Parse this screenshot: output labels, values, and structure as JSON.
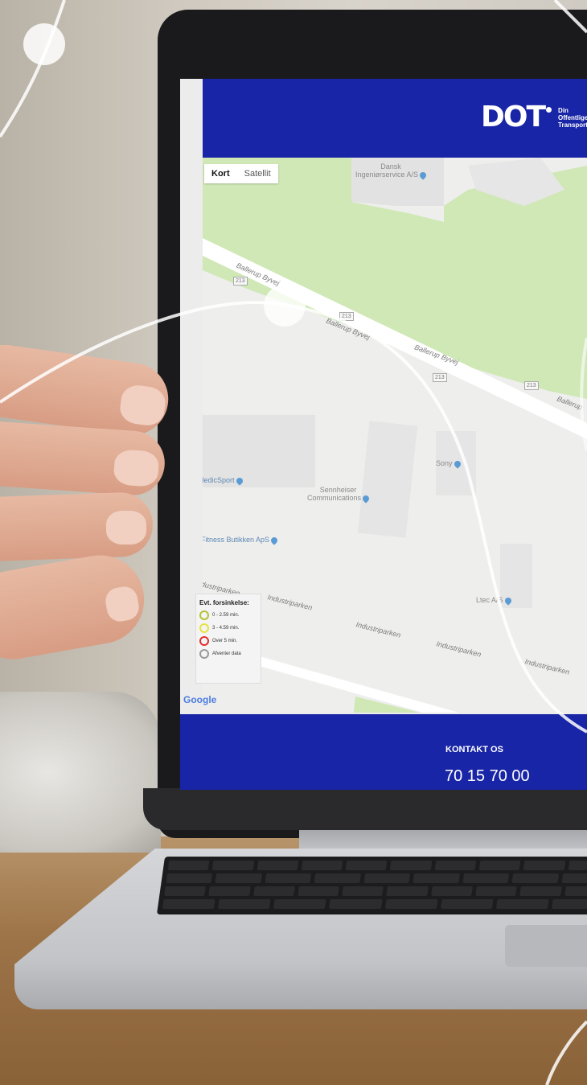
{
  "site": {
    "logo": "DOT",
    "logo_tagline": [
      "Din",
      "Offentlige",
      "Transport"
    ]
  },
  "map": {
    "toggle": {
      "kort": "Kort",
      "satellit": "Satellit"
    },
    "pois": {
      "dansk": "Dansk\nIngeniørservice A/S",
      "sony": "Sony",
      "medic": "MedicSport",
      "sennheiser": "Sennheiser\nCommunications",
      "fitness": "Fitness Butikken ApS",
      "ltec": "Ltec A/S"
    },
    "roads": {
      "ballerup1": "Ballerup Byvej",
      "ballerup2": "Ballerup Byvej",
      "ballerup3": "Ballerup Byvej",
      "ballerup4": "Ballerup",
      "industri1": "Industriparken",
      "industri2": "Industriparken",
      "industri3": "Industriparken",
      "industri4": "Industriparken",
      "industri5": "Industriparken"
    },
    "shields": [
      "213",
      "213",
      "213",
      "213"
    ],
    "attribution": "Google"
  },
  "legend": {
    "title": "Evt. forsinkelse:",
    "items": [
      {
        "label": "0 - 2.59 min.",
        "color": "#b5c234"
      },
      {
        "label": "3 - 4.59 min.",
        "color": "#e7e23a"
      },
      {
        "label": "Over 5 min.",
        "color": "#e0302d"
      },
      {
        "label": "Afventer data",
        "color": "#9a9a9a"
      }
    ]
  },
  "footer": {
    "title": "KONTAKT OS",
    "phone": "70 15 70 00"
  },
  "colors": {
    "brand": "#1825a6",
    "park": "#cfe8b6"
  }
}
